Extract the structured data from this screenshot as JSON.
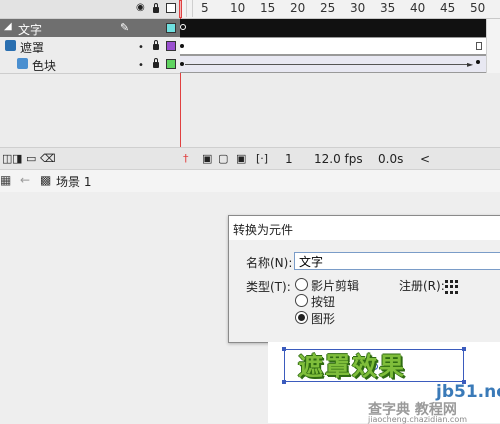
{
  "timeline": {
    "ruler_numbers": [
      "5",
      "10",
      "15",
      "20",
      "25",
      "30",
      "35",
      "40",
      "45",
      "50"
    ],
    "layers": [
      {
        "name": "文字",
        "color": "#6fe0e0",
        "selected": true
      },
      {
        "name": "遮罩",
        "color": "#9a4fd0",
        "selected": false
      },
      {
        "name": "色块",
        "color": "#5fd35f",
        "selected": false
      }
    ],
    "frame_number": "1",
    "fps": "12.0 fps",
    "elapsed": "0.0s"
  },
  "editbar": {
    "scene_label": "场景 1"
  },
  "dialog": {
    "title": "转换为元件",
    "name_label": "名称(N):",
    "name_value": "文字",
    "type_label": "类型(T):",
    "options": [
      "影片剪辑",
      "按钮",
      "图形"
    ],
    "selected_option": "图形",
    "registration_label": "注册(R):"
  },
  "preview": {
    "art_text": "遮罩效果"
  },
  "watermark": {
    "site": "jb51.net",
    "brand": "查字典 教程网",
    "url": "jiaocheng.chazidian.com"
  },
  "colors": {
    "selected_layer_bg": "#6f6f6f",
    "playhead": "#e04040",
    "selection_blue": "#3b5bbd",
    "art_green": "#7fbe3b"
  }
}
